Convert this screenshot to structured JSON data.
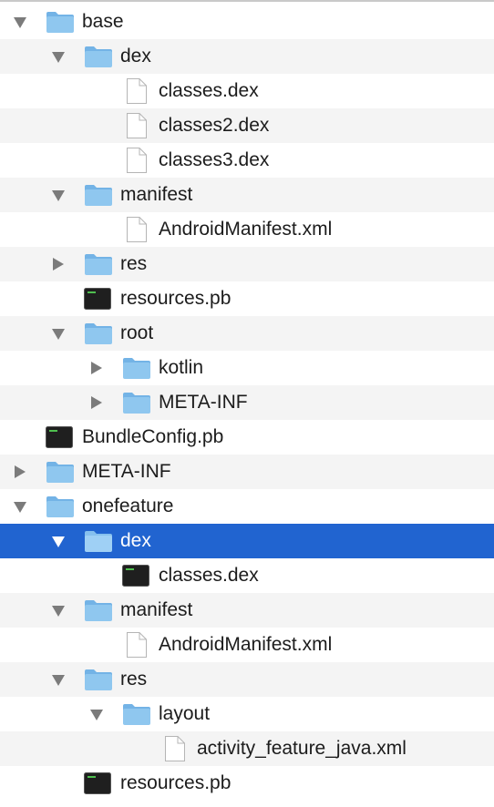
{
  "colors": {
    "selection": "#2164d0",
    "alt_row": "#f4f4f4",
    "folder": "#8fc7ef",
    "folder_tab": "#73b3e6"
  },
  "tree": [
    {
      "name": "base",
      "type": "folder",
      "depth": 0,
      "state": "expanded"
    },
    {
      "name": "dex",
      "type": "folder",
      "depth": 1,
      "state": "expanded"
    },
    {
      "name": "classes.dex",
      "type": "document",
      "depth": 2
    },
    {
      "name": "classes2.dex",
      "type": "document",
      "depth": 2
    },
    {
      "name": "classes3.dex",
      "type": "document",
      "depth": 2
    },
    {
      "name": "manifest",
      "type": "folder",
      "depth": 1,
      "state": "expanded"
    },
    {
      "name": "AndroidManifest.xml",
      "type": "document",
      "depth": 2
    },
    {
      "name": "res",
      "type": "folder",
      "depth": 1,
      "state": "collapsed"
    },
    {
      "name": "resources.pb",
      "type": "executable",
      "depth": 1
    },
    {
      "name": "root",
      "type": "folder",
      "depth": 1,
      "state": "expanded"
    },
    {
      "name": "kotlin",
      "type": "folder",
      "depth": 2,
      "state": "collapsed"
    },
    {
      "name": "META-INF",
      "type": "folder",
      "depth": 2,
      "state": "collapsed"
    },
    {
      "name": "BundleConfig.pb",
      "type": "executable",
      "depth": 0
    },
    {
      "name": "META-INF",
      "type": "folder",
      "depth": 0,
      "state": "collapsed"
    },
    {
      "name": "onefeature",
      "type": "folder",
      "depth": 0,
      "state": "expanded"
    },
    {
      "name": "dex",
      "type": "folder",
      "depth": 1,
      "state": "expanded",
      "selected": true
    },
    {
      "name": "classes.dex",
      "type": "executable",
      "depth": 2
    },
    {
      "name": "manifest",
      "type": "folder",
      "depth": 1,
      "state": "expanded"
    },
    {
      "name": "AndroidManifest.xml",
      "type": "document",
      "depth": 2
    },
    {
      "name": "res",
      "type": "folder",
      "depth": 1,
      "state": "expanded"
    },
    {
      "name": "layout",
      "type": "folder",
      "depth": 2,
      "state": "expanded"
    },
    {
      "name": "activity_feature_java.xml",
      "type": "document",
      "depth": 3
    },
    {
      "name": "resources.pb",
      "type": "executable",
      "depth": 1
    }
  ]
}
